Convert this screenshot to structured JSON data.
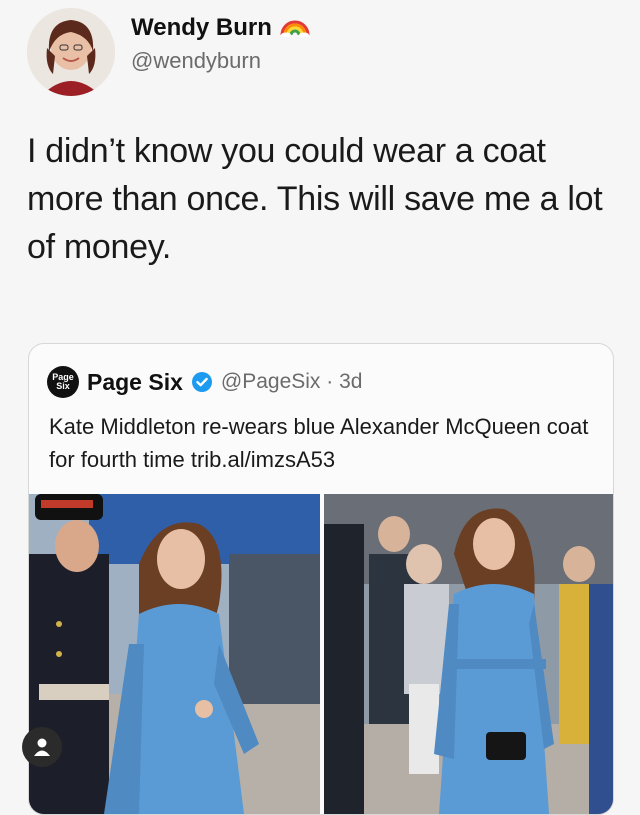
{
  "tweet": {
    "author_name": "Wendy Burn",
    "name_emoji": "rainbow-emoji",
    "author_handle": "@wendyburn",
    "text": "I didn’t know you could wear a coat more than once. This will save me a lot of money."
  },
  "quoted_tweet": {
    "logo_line1": "Page",
    "logo_line2": "Six",
    "author_name": "Page Six",
    "verified": true,
    "handle_time": "@PageSix · 3d",
    "text": "Kate Middleton re-wears blue Alexander McQueen coat for fourth time trib.al/imzsA53"
  },
  "colors": {
    "background": "#f6f6f6",
    "verified_blue": "#1d9bf0",
    "coat_blue": "#5b9bd5"
  },
  "icons": [
    "rainbow-emoji",
    "verified-badge-icon",
    "user-icon"
  ]
}
